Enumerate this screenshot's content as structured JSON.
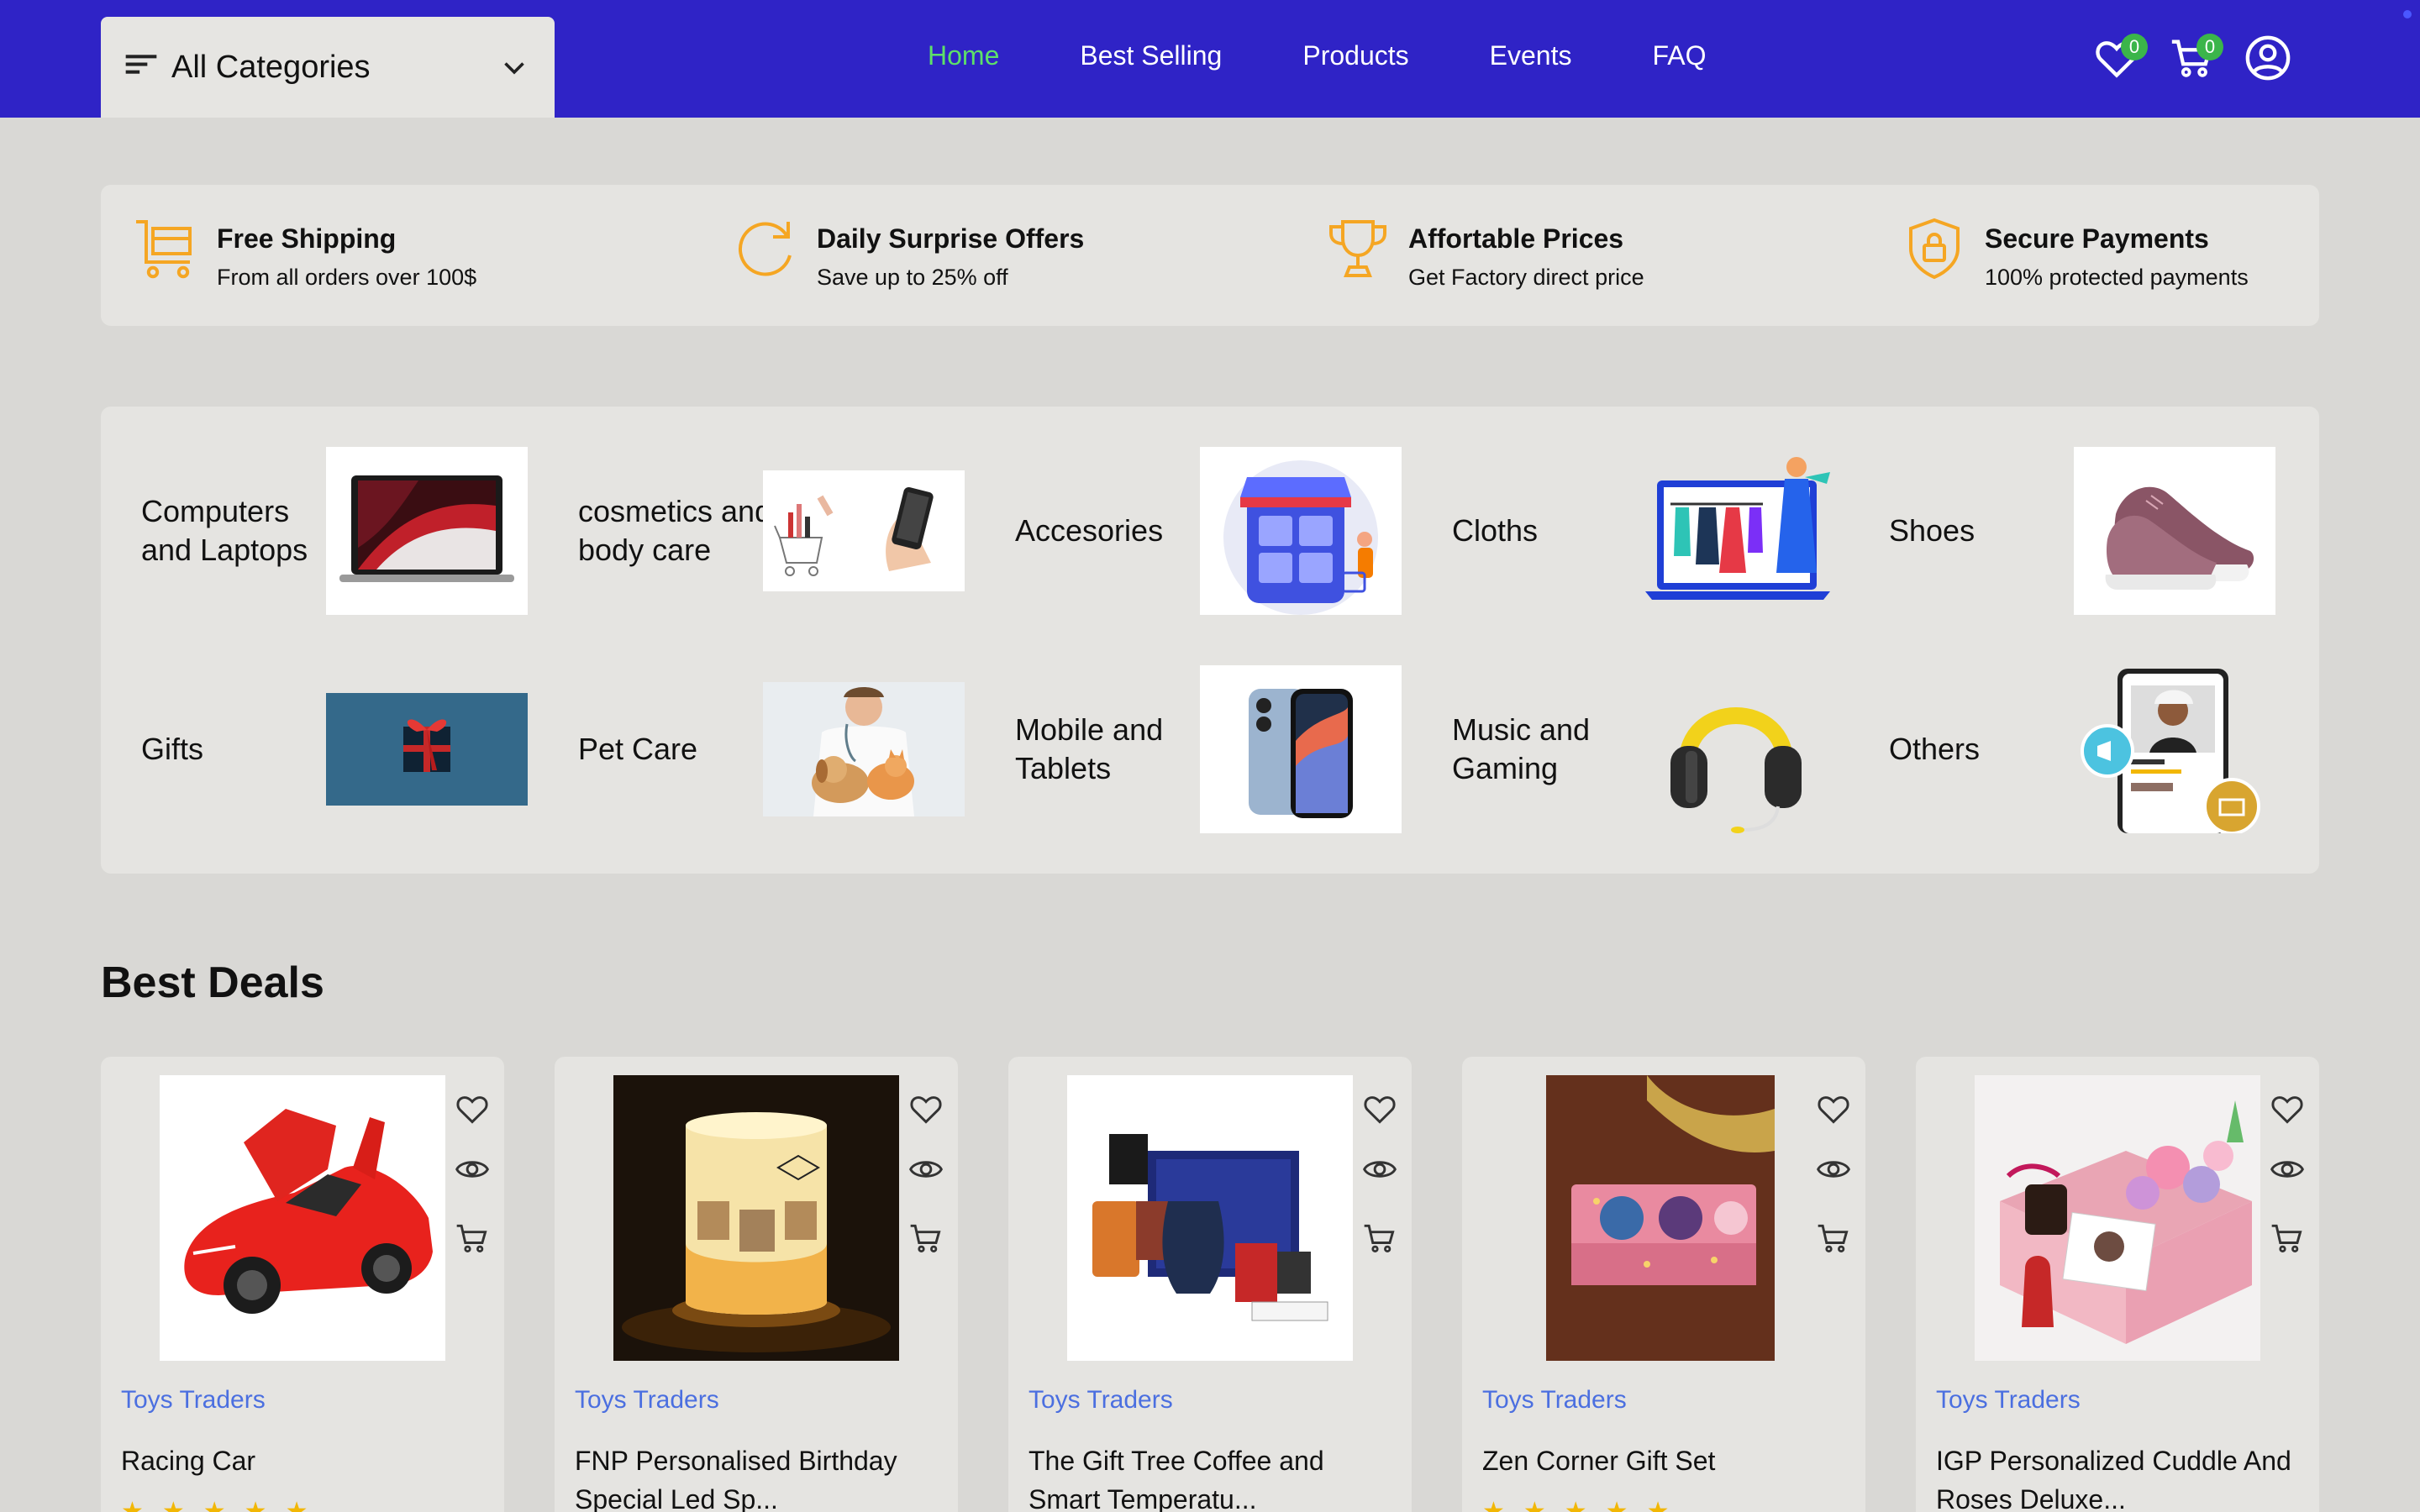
{
  "header": {
    "categories_label": "All Categories",
    "nav": [
      {
        "label": "Home",
        "active": true
      },
      {
        "label": "Best Selling",
        "active": false
      },
      {
        "label": "Products",
        "active": false
      },
      {
        "label": "Events",
        "active": false
      },
      {
        "label": "FAQ",
        "active": false
      }
    ],
    "wishlist_count": "0",
    "cart_count": "0",
    "colors": {
      "bar": "#2f23c6",
      "active_nav": "#5de069",
      "badge": "#3bb54a"
    }
  },
  "features": [
    {
      "title": "Free Shipping",
      "subtitle": "From all orders over 100$",
      "icon": "cart-icon"
    },
    {
      "title": "Daily Surprise Offers",
      "subtitle": "Save up to 25% off",
      "icon": "refresh-icon"
    },
    {
      "title": "Affortable Prices",
      "subtitle": "Get Factory direct price",
      "icon": "trophy-icon"
    },
    {
      "title": "Secure Payments",
      "subtitle": "100% protected payments",
      "icon": "shield-lock-icon"
    }
  ],
  "categories": [
    {
      "label": "Computers and Laptops",
      "icon": "laptop-image"
    },
    {
      "label": "cosmetics and body care",
      "icon": "cosmetics-image"
    },
    {
      "label": "Accesories",
      "icon": "accessories-image"
    },
    {
      "label": "Cloths",
      "icon": "cloths-image"
    },
    {
      "label": "Shoes",
      "icon": "shoes-image"
    },
    {
      "label": "Gifts",
      "icon": "gift-image"
    },
    {
      "label": "Pet Care",
      "icon": "pet-care-image"
    },
    {
      "label": "Mobile and Tablets",
      "icon": "phone-image"
    },
    {
      "label": "Music and Gaming",
      "icon": "headphones-image"
    },
    {
      "label": "Others",
      "icon": "others-image"
    }
  ],
  "deals": {
    "title": "Best Deals",
    "products": [
      {
        "shop": "Toys Traders",
        "name": "Racing Car",
        "image": "red-car-image"
      },
      {
        "shop": "Toys Traders",
        "name": "FNP Personalised Birthday Special Led Sp...",
        "image": "birthday-lamp-image"
      },
      {
        "shop": "Toys Traders",
        "name": "The Gift Tree Coffee and Smart Temperatu...",
        "image": "coffee-gift-image"
      },
      {
        "shop": "Toys Traders",
        "name": "Zen Corner Gift Set",
        "image": "gift-set-image"
      },
      {
        "shop": "Toys Traders",
        "name": "IGP Personalized Cuddle And Roses Deluxe...",
        "image": "roses-box-image"
      }
    ],
    "star_color": "#f2b705",
    "link_color": "#4b6fe0"
  }
}
